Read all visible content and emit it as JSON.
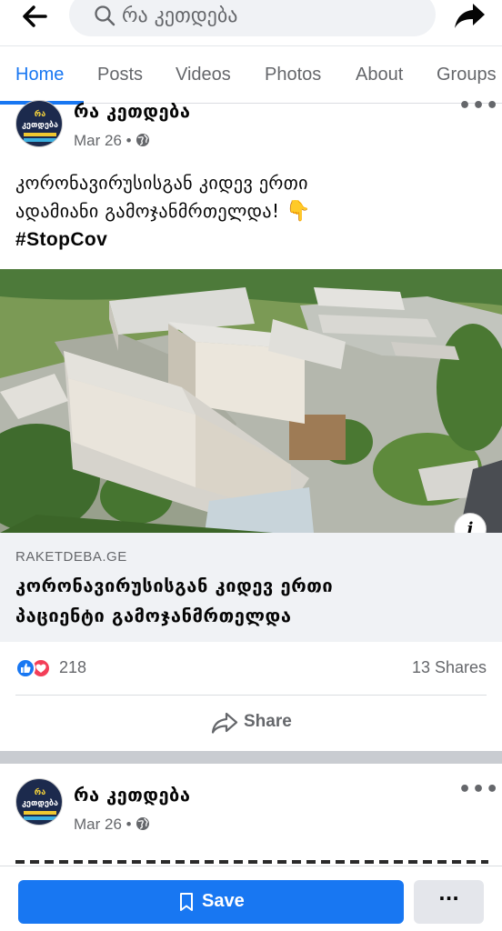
{
  "search": {
    "placeholder": "რა კეთდება"
  },
  "tabs": [
    {
      "label": "Home",
      "active": true
    },
    {
      "label": "Posts"
    },
    {
      "label": "Videos"
    },
    {
      "label": "Photos"
    },
    {
      "label": "About"
    },
    {
      "label": "Groups"
    }
  ],
  "posts": [
    {
      "page_name": "რა კეთდება",
      "date": "Mar 26 •",
      "text_line1": "კორონავირუსისგან კიდევ ერთი",
      "text_line2": "ადამიანი გამოჯანმრთელდა!",
      "hashtag": "#StopCov",
      "link_domain": "RAKETDEBA.GE",
      "link_title_line1": "კორონავირუსისგან კიდევ ერთი",
      "link_title_line2": "პაციენტი გამოჯანმრთელდა",
      "reaction_count": "218",
      "shares": "13 Shares",
      "share_label": "Share"
    },
    {
      "page_name": "რა კეთდება",
      "date": "Mar 26 •"
    }
  ],
  "avatar": {
    "line1": "რა",
    "line2": "კეთდება"
  },
  "bottom": {
    "save_label": "Save",
    "more_label": "···"
  },
  "colors": {
    "accent": "#1877f2",
    "love": "#f33e58",
    "separator": "#c9ccd1"
  }
}
